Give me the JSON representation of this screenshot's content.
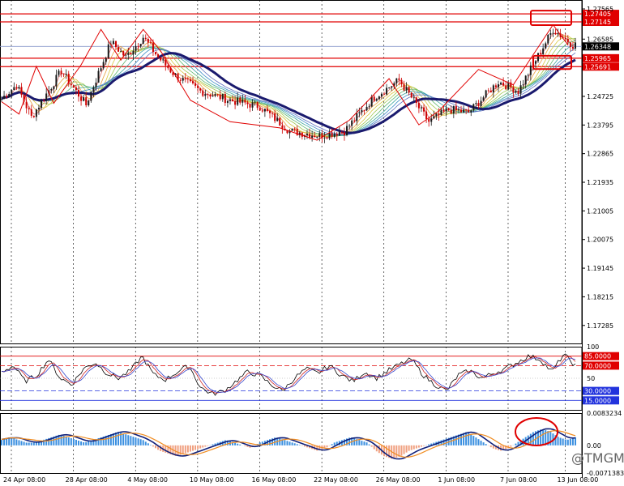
{
  "watermark": "@TMGM",
  "colors": {
    "bull": "#1a1a1a",
    "bear": "#cc0000",
    "red_line": "#e00000",
    "blue_line": "#2233dd",
    "ma_slow": "#1a1a6e",
    "grid": "#000000",
    "price_tag": "#000000"
  },
  "chart_data": [
    {
      "type": "candlestick",
      "panel": "main",
      "ylim": [
        1.167,
        1.2775
      ],
      "price_scale_labels": [
        "1.27565",
        "1.26585",
        "1.24725",
        "1.23795",
        "1.22865",
        "1.21935",
        "1.21005",
        "1.20075",
        "1.19145",
        "1.18215",
        "1.17285"
      ],
      "resistance_lines": [
        {
          "value": 1.27405,
          "label": "1.27405"
        },
        {
          "value": 1.27145,
          "label": "1.27145"
        },
        {
          "value": 1.25965,
          "label": "1.25965"
        },
        {
          "value": 1.25691,
          "label": "1.25691"
        }
      ],
      "current_price": {
        "value": 1.26348,
        "label": "1.26348"
      },
      "x_labels": [
        "24 Apr 08:00",
        "28 Apr 08:00",
        "4 May 08:00",
        "10 May 08:00",
        "16 May 08:00",
        "22 May 08:00",
        "26 May 08:00",
        "1 Jun 08:00",
        "7 Jun 08:00",
        "13 Jun 08:00"
      ],
      "swing_points": [
        {
          "i": 0,
          "v": 1.2465
        },
        {
          "i": 6,
          "v": 1.251
        },
        {
          "i": 12,
          "v": 1.2405
        },
        {
          "i": 24,
          "v": 1.2555
        },
        {
          "i": 34,
          "v": 1.2445
        },
        {
          "i": 44,
          "v": 1.265
        },
        {
          "i": 50,
          "v": 1.26
        },
        {
          "i": 57,
          "v": 1.2665
        },
        {
          "i": 63,
          "v": 1.26
        },
        {
          "i": 70,
          "v": 1.254
        },
        {
          "i": 80,
          "v": 1.249
        },
        {
          "i": 92,
          "v": 1.246
        },
        {
          "i": 104,
          "v": 1.244
        },
        {
          "i": 116,
          "v": 1.236
        },
        {
          "i": 128,
          "v": 1.2345
        },
        {
          "i": 138,
          "v": 1.236
        },
        {
          "i": 150,
          "v": 1.247
        },
        {
          "i": 160,
          "v": 1.2525
        },
        {
          "i": 172,
          "v": 1.239
        },
        {
          "i": 180,
          "v": 1.243
        },
        {
          "i": 188,
          "v": 1.242
        },
        {
          "i": 200,
          "v": 1.252
        },
        {
          "i": 208,
          "v": 1.249
        },
        {
          "i": 222,
          "v": 1.269
        },
        {
          "i": 230,
          "v": 1.264
        }
      ],
      "zigzag": [
        {
          "i": 0,
          "v": 1.2455
        },
        {
          "i": 7,
          "v": 1.2415
        },
        {
          "i": 14,
          "v": 1.257
        },
        {
          "i": 21,
          "v": 1.245
        },
        {
          "i": 32,
          "v": 1.2575
        },
        {
          "i": 40,
          "v": 1.269
        },
        {
          "i": 48,
          "v": 1.259
        },
        {
          "i": 57,
          "v": 1.269
        },
        {
          "i": 64,
          "v": 1.262
        },
        {
          "i": 76,
          "v": 1.246
        },
        {
          "i": 92,
          "v": 1.239
        },
        {
          "i": 112,
          "v": 1.237
        },
        {
          "i": 127,
          "v": 1.233
        },
        {
          "i": 140,
          "v": 1.2395
        },
        {
          "i": 156,
          "v": 1.253
        },
        {
          "i": 168,
          "v": 1.238
        },
        {
          "i": 176,
          "v": 1.2425
        },
        {
          "i": 192,
          "v": 1.256
        },
        {
          "i": 206,
          "v": 1.251
        },
        {
          "i": 222,
          "v": 1.2705
        },
        {
          "i": 228,
          "v": 1.264
        }
      ]
    },
    {
      "type": "line",
      "panel": "rsi",
      "ylim": [
        0,
        100
      ],
      "levels": [
        {
          "value": 85,
          "label": "85.0000",
          "color": "#e00000"
        },
        {
          "value": 70,
          "label": "70.0000",
          "color": "#e00000"
        },
        {
          "value": 30,
          "label": "30.0000",
          "color": "#2233dd"
        },
        {
          "value": 15,
          "label": "15.0000",
          "color": "#2233dd"
        }
      ],
      "scale_labels": [
        "100",
        "50"
      ],
      "series_seed": [
        60,
        70,
        45,
        55,
        80,
        50,
        40,
        65,
        75,
        58,
        50,
        62,
        85,
        55,
        48,
        60,
        70,
        35,
        25,
        30,
        45,
        60,
        55,
        40,
        30,
        50,
        65,
        58,
        70,
        55,
        45,
        60,
        50,
        62,
        72,
        80,
        55,
        40,
        30,
        55,
        62,
        50,
        58,
        65,
        75,
        85,
        80,
        60,
        88,
        70
      ]
    },
    {
      "type": "bar+line",
      "panel": "macd",
      "ylim": [
        -0.0071383,
        0.0083234
      ],
      "scale_labels": [
        "0.0083234",
        "0.00",
        "-0.0071383"
      ],
      "hist_seed": [
        2,
        3,
        2,
        1,
        1,
        2,
        3,
        4,
        3,
        2,
        1,
        2,
        3,
        4,
        5,
        4,
        3,
        2,
        0,
        -2,
        -3,
        -4,
        -3,
        -2,
        -1,
        0,
        1,
        2,
        1,
        0,
        -1,
        1,
        2,
        3,
        2,
        1,
        0,
        -1,
        -2,
        -1,
        1,
        2,
        3,
        2,
        1,
        -2,
        -4,
        -5,
        -4,
        -2,
        -1,
        0,
        1,
        2,
        3,
        4,
        5,
        3,
        1,
        -1,
        -2,
        -1,
        1,
        3,
        5,
        6,
        5,
        3,
        2,
        3
      ]
    }
  ]
}
